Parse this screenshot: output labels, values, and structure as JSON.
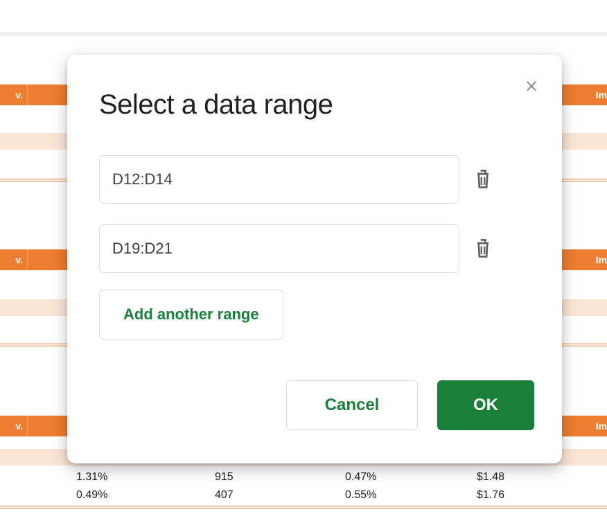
{
  "modal": {
    "title": "Select a data range",
    "ranges": [
      "D12:D14",
      "D19:D21"
    ],
    "add_label": "Add another range",
    "cancel_label": "Cancel",
    "ok_label": "OK"
  },
  "background": {
    "header_fragment_left": "v.",
    "header_fragment_right": "Im",
    "rows": [
      {
        "c1": "1.31%",
        "c2": "915",
        "c3": "0.47%",
        "c4": "$1.48"
      },
      {
        "c1": "0.49%",
        "c2": "407",
        "c3": "0.55%",
        "c4": "$1.76"
      }
    ]
  }
}
